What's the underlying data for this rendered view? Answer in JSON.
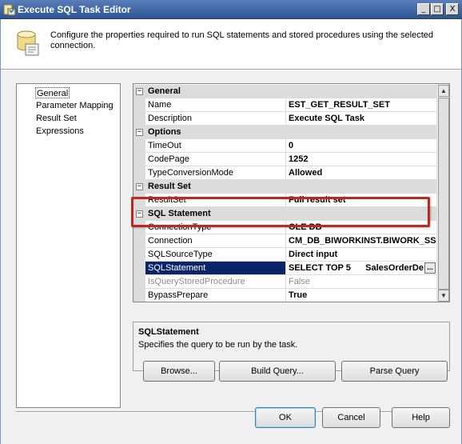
{
  "window": {
    "title": "Execute SQL Task Editor",
    "minimize": "_",
    "maximize": "□",
    "close": "X"
  },
  "header": {
    "text": "Configure the properties required to run SQL statements and stored procedures using the selected connection."
  },
  "nav": {
    "items": [
      {
        "label": "General",
        "selected": true
      },
      {
        "label": "Parameter Mapping",
        "selected": false
      },
      {
        "label": "Result Set",
        "selected": false
      },
      {
        "label": "Expressions",
        "selected": false
      }
    ]
  },
  "grid": {
    "rows": [
      {
        "kind": "category",
        "label": "General",
        "expander": "⊟"
      },
      {
        "kind": "property",
        "name": "Name",
        "value": "EST_GET_RESULT_SET"
      },
      {
        "kind": "property",
        "name": "Description",
        "value": "Execute SQL Task"
      },
      {
        "kind": "category",
        "label": "Options",
        "expander": "⊟"
      },
      {
        "kind": "property",
        "name": "TimeOut",
        "value": "0"
      },
      {
        "kind": "property",
        "name": "CodePage",
        "value": "1252"
      },
      {
        "kind": "property",
        "name": "TypeConversionMode",
        "value": "Allowed"
      },
      {
        "kind": "category",
        "label": "Result Set",
        "expander": "⊟"
      },
      {
        "kind": "property",
        "name": "ResultSet",
        "value": "Full result set"
      },
      {
        "kind": "category",
        "label": "SQL Statement",
        "expander": "⊟"
      },
      {
        "kind": "property",
        "name": "ConnectionType",
        "value": "OLE DB"
      },
      {
        "kind": "property",
        "name": "Connection",
        "value": "CM_DB_BIWORKINST.BIWORK_SS"
      },
      {
        "kind": "property",
        "name": "SQLSourceType",
        "value": "Direct input"
      },
      {
        "kind": "property",
        "name": "SQLStatement",
        "value": "SELECT TOP 5      SalesOrderDe",
        "selected": true,
        "ellipsis": "..."
      },
      {
        "kind": "property",
        "name": "IsQueryStoredProcedure",
        "value": "False",
        "disabled": true
      },
      {
        "kind": "property",
        "name": "BypassPrepare",
        "value": "True"
      }
    ]
  },
  "description": {
    "title": "SQLStatement",
    "text": "Specifies the query to be run by the task."
  },
  "buttons": {
    "browse": "Browse...",
    "build_query": "Build Query...",
    "parse_query": "Parse Query",
    "ok": "OK",
    "cancel": "Cancel",
    "help": "Help"
  },
  "scrollbar": {
    "up": "▲",
    "down": "▼"
  },
  "colors": {
    "highlight_border": "#c2261f",
    "selected_row": "#0a246a",
    "title_bar": "#3f66a6"
  }
}
